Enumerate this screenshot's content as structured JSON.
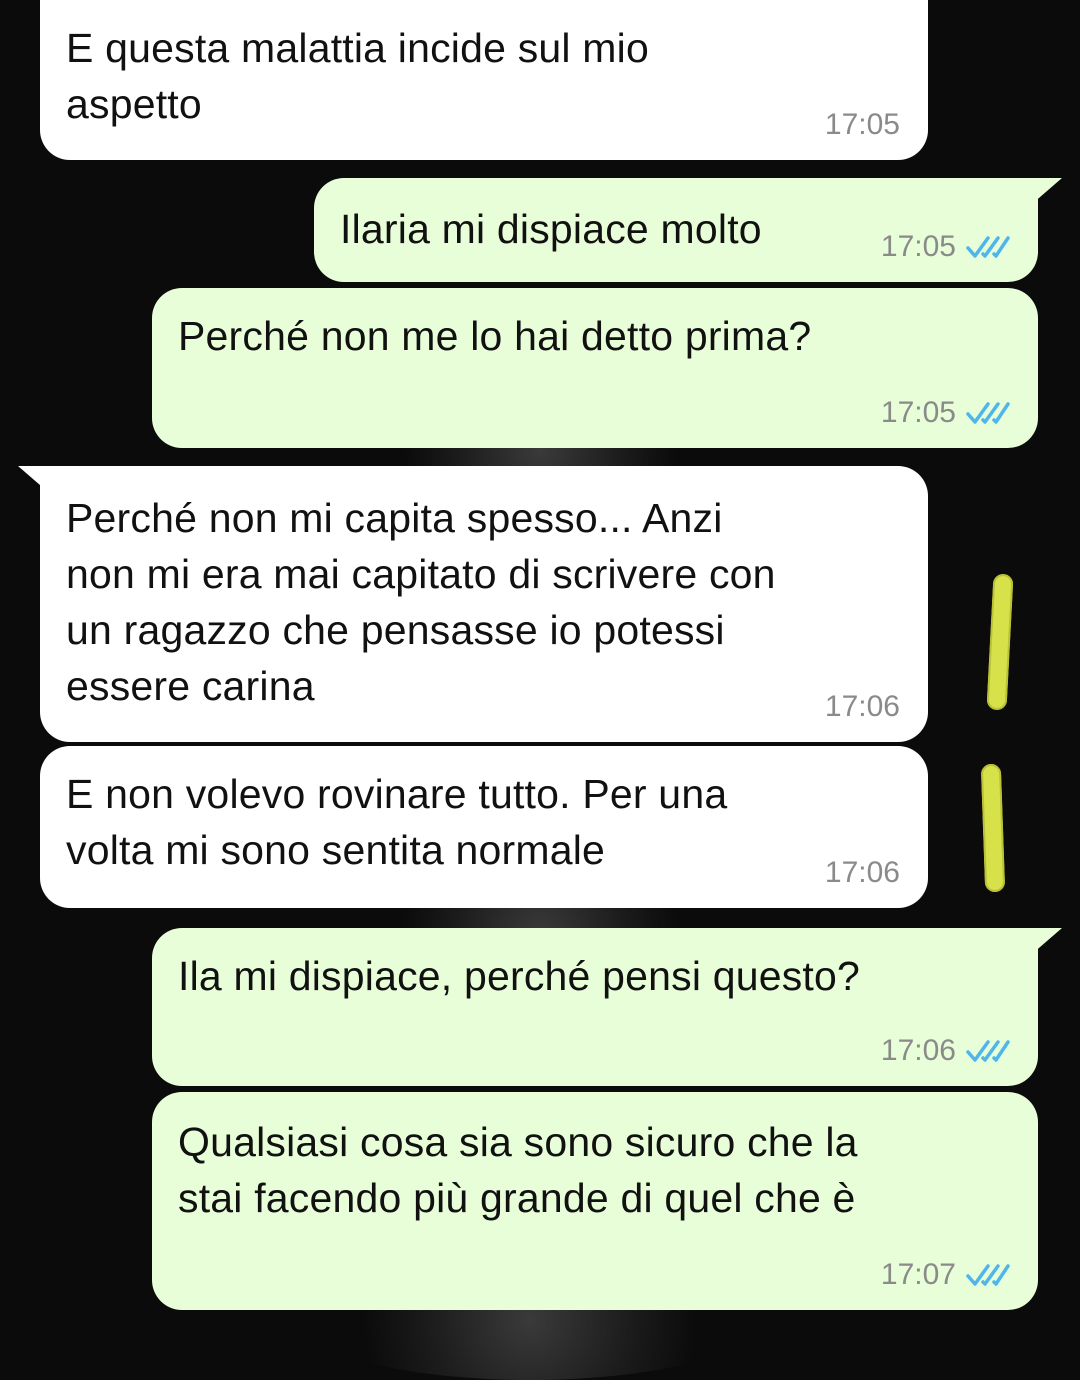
{
  "messages": [
    {
      "direction": "incoming",
      "text": "E questa malattia incide sul mio\naspetto",
      "time": "17:05"
    },
    {
      "direction": "outgoing",
      "text": "Ilaria mi dispiace molto",
      "time": "17:05",
      "status": "read"
    },
    {
      "direction": "outgoing",
      "text": "Perché non me lo hai detto prima?",
      "time": "17:05",
      "status": "read"
    },
    {
      "direction": "incoming",
      "text": "Perché non mi capita spesso... Anzi\nnon mi era mai capitato di scrivere con\nun ragazzo che pensasse io potessi\nessere carina",
      "time": "17:06"
    },
    {
      "direction": "incoming",
      "text": "E non volevo rovinare tutto. Per una\nvolta mi sono sentita normale",
      "time": "17:06"
    },
    {
      "direction": "outgoing",
      "text": "Ila mi dispiace, perché pensi questo?",
      "time": "17:06",
      "status": "read"
    },
    {
      "direction": "outgoing",
      "text": "Qualsiasi cosa sia sono sicuro che la\nstai facendo più grande di quel che è",
      "time": "17:07",
      "status": "read"
    }
  ],
  "colors": {
    "background": "#0b0b0b",
    "incoming_bubble": "#ffffff",
    "outgoing_bubble": "#e7fed8",
    "time_text": "#8a8a8a",
    "read_ticks": "#4fb6ec",
    "highlight_marks": "#d7e14a"
  },
  "icons": {
    "read_status": "double-check-icon"
  }
}
